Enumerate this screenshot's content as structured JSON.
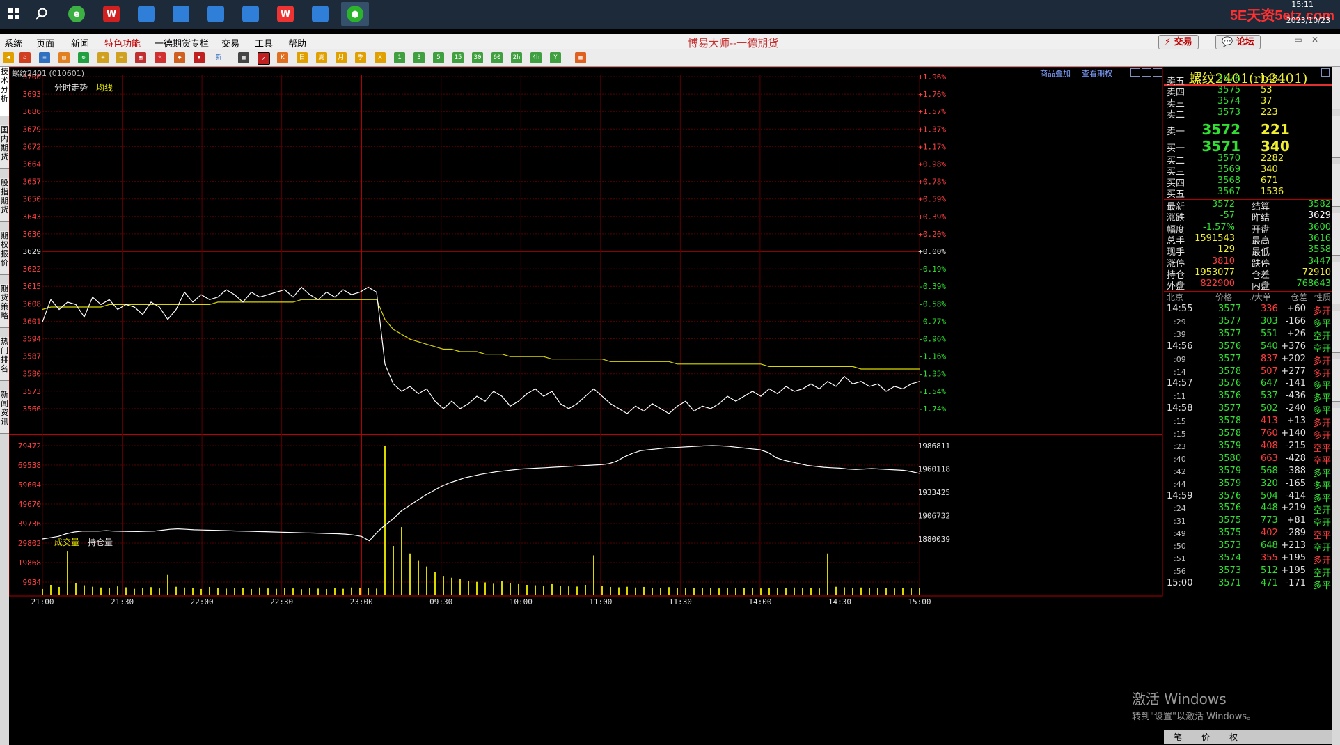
{
  "taskbar": {
    "apps": [
      {
        "icon": "windows-start-icon",
        "active": false
      },
      {
        "icon": "search-icon",
        "active": false
      },
      {
        "icon": "browser-icon",
        "active": false
      },
      {
        "icon": "wind-app-icon",
        "active": false
      },
      {
        "icon": "app-window-icon",
        "active": false
      },
      {
        "icon": "app-window-icon",
        "active": false
      },
      {
        "icon": "app-window-icon",
        "active": false
      },
      {
        "icon": "app-window-icon",
        "active": false
      },
      {
        "icon": "wps-icon",
        "active": false
      },
      {
        "icon": "app-window-icon",
        "active": false
      },
      {
        "icon": "wechat-icon",
        "active": true
      }
    ],
    "clock_time": "15:11",
    "clock_date": "2023/10/23",
    "watermark": "5E天资5etz.com"
  },
  "menubar": {
    "items": [
      "系统",
      "页面",
      "新闻",
      "特色功能",
      "一德期货专栏",
      "交易",
      "工具",
      "帮助"
    ],
    "title": "博易大师--一德期货",
    "trade_btn": "交易",
    "forum_btn": "论坛"
  },
  "left_tabs": [
    "技术分析",
    "国内期货",
    "股指期货",
    "期权报价",
    "期货策略",
    "热门排名",
    "新闻资讯"
  ],
  "chart": {
    "header_symbol": "螺纹2401 (010601)",
    "header_links": [
      "商品叠加",
      "查看期权"
    ],
    "price_legend": [
      "分时走势",
      "均线"
    ],
    "volume_legend": [
      "成交量",
      "持仓量"
    ],
    "price_ticks": [
      "3700",
      "3693",
      "3686",
      "3679",
      "3672",
      "3664",
      "3657",
      "3650",
      "3643",
      "3636",
      "3629",
      "3622",
      "3615",
      "3608",
      "3601",
      "3594",
      "3587",
      "3580",
      "3573",
      "3566"
    ],
    "pct_ticks": [
      "+1.96%",
      "+1.76%",
      "+1.57%",
      "+1.37%",
      "+1.17%",
      "+0.98%",
      "+0.78%",
      "+0.59%",
      "+0.39%",
      "+0.20%",
      "+0.00%",
      "-0.19%",
      "-0.39%",
      "-0.58%",
      "-0.77%",
      "-0.96%",
      "-1.16%",
      "-1.35%",
      "-1.54%",
      "-1.74%"
    ],
    "vol_ticks": [
      "79472",
      "69538",
      "59604",
      "49670",
      "39736",
      "29802",
      "19868",
      "9934"
    ],
    "oi_ticks": [
      "1986811",
      "1960118",
      "1933425",
      "1906732",
      "1880039"
    ],
    "time_ticks": [
      "21:00",
      "21:30",
      "22:00",
      "22:30",
      "23:00",
      "09:30",
      "10:00",
      "11:00",
      "11:30",
      "14:00",
      "14:30",
      "15:00"
    ],
    "colors": {
      "grid": "#8b0000",
      "price_line": "#ffffff",
      "avg_line": "#d8d800",
      "volume": "#d8d800",
      "oi_line": "#ffffff"
    }
  },
  "chart_data": {
    "type": "line",
    "title": "螺纹2401 (010601)",
    "prev_settle": 3629,
    "ylim": [
      3563,
      3703
    ],
    "time_labels": [
      "21:00",
      "21:30",
      "22:00",
      "22:30",
      "23:00",
      "09:30",
      "10:00",
      "11:00",
      "11:30",
      "14:00",
      "14:30",
      "15:00"
    ],
    "series": [
      {
        "name": "分时走势",
        "values": [
          3601,
          3610,
          3606,
          3609,
          3608,
          3603,
          3611,
          3608,
          3610,
          3606,
          3608,
          3607,
          3604,
          3609,
          3607,
          3602,
          3606,
          3613,
          3609,
          3612,
          3610,
          3611,
          3614,
          3612,
          3609,
          3613,
          3611,
          3612,
          3613,
          3614,
          3611,
          3615,
          3612,
          3610,
          3613,
          3611,
          3614,
          3612,
          3613,
          3615,
          3613,
          3584,
          3576,
          3573,
          3575,
          3572,
          3574,
          3569,
          3566,
          3569,
          3566,
          3568,
          3571,
          3569,
          3573,
          3571,
          3567,
          3569,
          3572,
          3574,
          3571,
          3573,
          3568,
          3566,
          3568,
          3571,
          3574,
          3571,
          3568,
          3566,
          3564,
          3567,
          3565,
          3568,
          3566,
          3564,
          3567,
          3569,
          3565,
          3567,
          3566,
          3568,
          3571,
          3569,
          3571,
          3573,
          3571,
          3574,
          3572,
          3575,
          3573,
          3574,
          3576,
          3574,
          3577,
          3575,
          3579,
          3576,
          3577,
          3575,
          3576,
          3573,
          3575,
          3574,
          3576,
          3577
        ],
        "color": "#ffffff"
      },
      {
        "name": "均线",
        "values": [
          3606,
          3607,
          3607,
          3607,
          3607,
          3607,
          3607,
          3607,
          3608,
          3608,
          3608,
          3608,
          3608,
          3608,
          3608,
          3608,
          3608,
          3608,
          3608,
          3608,
          3608,
          3609,
          3609,
          3609,
          3609,
          3609,
          3609,
          3609,
          3609,
          3609,
          3609,
          3610,
          3610,
          3610,
          3610,
          3610,
          3610,
          3610,
          3610,
          3610,
          3610,
          3602,
          3598,
          3596,
          3594,
          3593,
          3592,
          3591,
          3590,
          3590,
          3589,
          3589,
          3589,
          3588,
          3588,
          3588,
          3587,
          3587,
          3587,
          3587,
          3587,
          3586,
          3586,
          3586,
          3586,
          3586,
          3586,
          3586,
          3585,
          3585,
          3585,
          3585,
          3585,
          3585,
          3585,
          3585,
          3584,
          3584,
          3584,
          3584,
          3584,
          3584,
          3584,
          3584,
          3584,
          3584,
          3584,
          3583,
          3583,
          3583,
          3583,
          3583,
          3583,
          3583,
          3583,
          3583,
          3583,
          3583,
          3582,
          3582,
          3582,
          3582,
          3582,
          3582,
          3582,
          3582
        ],
        "color": "#d8d800"
      }
    ],
    "volume": {
      "ylim": [
        0,
        79472
      ],
      "values": [
        3000,
        5200,
        4100,
        23000,
        6000,
        5000,
        4200,
        3800,
        3500,
        4400,
        3900,
        3100,
        3600,
        4000,
        3300,
        10500,
        4200,
        3800,
        3500,
        3000,
        4100,
        3400,
        3200,
        3700,
        3500,
        3000,
        3800,
        3300,
        3100,
        3600,
        3300,
        2900,
        3500,
        3200,
        3000,
        3400,
        3100,
        3800,
        3600,
        3400,
        3200,
        79472,
        26000,
        36000,
        22000,
        18000,
        15000,
        12000,
        10000,
        9000,
        8500,
        7200,
        6800,
        6500,
        5800,
        7400,
        6000,
        5600,
        5200,
        5000,
        4800,
        5600,
        4700,
        4400,
        4300,
        5200,
        21000,
        4600,
        4100,
        3900,
        4200,
        3800,
        4100,
        3700,
        3600,
        4000,
        3700,
        3500,
        3600,
        3400,
        3700,
        3300,
        3600,
        3500,
        3400,
        3700,
        3300,
        3600,
        3400,
        3500,
        3800,
        3400,
        3600,
        3300,
        22000,
        4200,
        3900,
        3600,
        3800,
        3500,
        3400,
        3600,
        3300,
        3500,
        3300,
        3600
      ]
    },
    "open_interest": {
      "ylim": [
        1873000,
        1993000
      ],
      "values": [
        1880039,
        1881500,
        1883000,
        1886000,
        1888000,
        1889000,
        1889000,
        1889000,
        1889500,
        1889000,
        1888800,
        1888600,
        1888500,
        1888800,
        1889000,
        1890000,
        1891000,
        1891500,
        1891000,
        1890500,
        1890200,
        1890000,
        1889800,
        1889500,
        1889200,
        1889000,
        1888800,
        1888500,
        1888300,
        1888000,
        1887800,
        1887500,
        1887200,
        1887000,
        1886800,
        1886500,
        1886200,
        1886000,
        1885500,
        1884500,
        1883000,
        1878000,
        1888000,
        1896000,
        1903000,
        1912000,
        1918000,
        1924000,
        1930000,
        1935000,
        1940000,
        1944000,
        1947000,
        1950000,
        1952000,
        1954000,
        1955500,
        1957000,
        1958000,
        1959000,
        1960000,
        1960500,
        1961000,
        1961500,
        1962000,
        1962500,
        1963000,
        1963500,
        1964000,
        1964500,
        1965000,
        1966000,
        1969000,
        1974000,
        1978000,
        1981000,
        1982000,
        1983000,
        1984000,
        1984500,
        1985000,
        1985500,
        1986000,
        1986500,
        1986811,
        1986500,
        1986000,
        1985000,
        1984000,
        1983000,
        1982000,
        1979000,
        1973000,
        1970000,
        1968000,
        1966000,
        1964000,
        1963000,
        1962000,
        1961500,
        1961000,
        1960000,
        1959500,
        1960000,
        1960500,
        1960000,
        1959500,
        1959000,
        1958500,
        1957000,
        1955000
      ]
    }
  },
  "panel": {
    "title": "螺纹2401(rb2401)",
    "asks": [
      {
        "label": "卖五",
        "price": "3576",
        "vol": "148"
      },
      {
        "label": "卖四",
        "price": "3575",
        "vol": "53"
      },
      {
        "label": "卖三",
        "price": "3574",
        "vol": "37"
      },
      {
        "label": "卖二",
        "price": "3573",
        "vol": "223"
      },
      {
        "label": "卖一",
        "price": "3572",
        "vol": "221"
      }
    ],
    "bids": [
      {
        "label": "买一",
        "price": "3571",
        "vol": "340"
      },
      {
        "label": "买二",
        "price": "3570",
        "vol": "2282"
      },
      {
        "label": "买三",
        "price": "3569",
        "vol": "340"
      },
      {
        "label": "买四",
        "price": "3568",
        "vol": "671"
      },
      {
        "label": "买五",
        "price": "3567",
        "vol": "1536"
      }
    ],
    "quote": [
      {
        "l1": "最新",
        "v1": "3572",
        "c1": "green",
        "l2": "结算",
        "v2": "3582",
        "c2": "green"
      },
      {
        "l1": "涨跌",
        "v1": "-57",
        "c1": "green",
        "l2": "昨结",
        "v2": "3629",
        "c2": "white"
      },
      {
        "l1": "幅度",
        "v1": "-1.57%",
        "c1": "green",
        "l2": "开盘",
        "v2": "3600",
        "c2": "green"
      },
      {
        "l1": "总手",
        "v1": "1591543",
        "c1": "yellow",
        "l2": "最高",
        "v2": "3616",
        "c2": "green"
      },
      {
        "l1": "现手",
        "v1": "129",
        "c1": "yellow",
        "l2": "最低",
        "v2": "3558",
        "c2": "green"
      },
      {
        "l1": "涨停",
        "v1": "3810",
        "c1": "red",
        "l2": "跌停",
        "v2": "3447",
        "c2": "green"
      },
      {
        "l1": "持仓",
        "v1": "1953077",
        "c1": "yellow",
        "l2": "仓差",
        "v2": "72910",
        "c2": "yellow"
      },
      {
        "l1": "外盘",
        "v1": "822900",
        "c1": "red",
        "l2": "内盘",
        "v2": "768643",
        "c2": "green"
      }
    ],
    "trades_header": [
      "北京",
      "价格",
      "./大单",
      "仓差",
      "性质"
    ],
    "trades": [
      {
        "time": "14:55",
        "main": true,
        "price": "3577",
        "vol": "336",
        "vc": "red",
        "chg": "+60",
        "typ": "多开",
        "tc": "red"
      },
      {
        "time": ":29",
        "main": false,
        "price": "3577",
        "vol": "303",
        "vc": "green",
        "chg": "-166",
        "typ": "多平",
        "tc": "green"
      },
      {
        "time": ":39",
        "main": false,
        "price": "3577",
        "vol": "551",
        "vc": "green",
        "chg": "+26",
        "typ": "空开",
        "tc": "green"
      },
      {
        "time": "14:56",
        "main": true,
        "price": "3576",
        "vol": "540",
        "vc": "green",
        "chg": "+376",
        "typ": "空开",
        "tc": "green"
      },
      {
        "time": ":09",
        "main": false,
        "price": "3577",
        "vol": "837",
        "vc": "red",
        "chg": "+202",
        "typ": "多开",
        "tc": "red"
      },
      {
        "time": ":14",
        "main": false,
        "price": "3578",
        "vol": "507",
        "vc": "red",
        "chg": "+277",
        "typ": "多开",
        "tc": "red"
      },
      {
        "time": "14:57",
        "main": true,
        "price": "3576",
        "vol": "647",
        "vc": "green",
        "chg": "-141",
        "typ": "多平",
        "tc": "green"
      },
      {
        "time": ":11",
        "main": false,
        "price": "3576",
        "vol": "537",
        "vc": "green",
        "chg": "-436",
        "typ": "多平",
        "tc": "green"
      },
      {
        "time": "14:58",
        "main": true,
        "price": "3577",
        "vol": "502",
        "vc": "green",
        "chg": "-240",
        "typ": "多平",
        "tc": "green"
      },
      {
        "time": ":15",
        "main": false,
        "price": "3578",
        "vol": "413",
        "vc": "red",
        "chg": "+13",
        "typ": "多开",
        "tc": "red"
      },
      {
        "time": ":15",
        "main": false,
        "price": "3578",
        "vol": "760",
        "vc": "red",
        "chg": "+140",
        "typ": "多开",
        "tc": "red"
      },
      {
        "time": ":23",
        "main": false,
        "price": "3579",
        "vol": "408",
        "vc": "red",
        "chg": "-215",
        "typ": "空平",
        "tc": "red"
      },
      {
        "time": ":40",
        "main": false,
        "price": "3580",
        "vol": "663",
        "vc": "red",
        "chg": "-428",
        "typ": "空平",
        "tc": "red"
      },
      {
        "time": ":42",
        "main": false,
        "price": "3579",
        "vol": "568",
        "vc": "green",
        "chg": "-388",
        "typ": "多平",
        "tc": "green"
      },
      {
        "time": ":44",
        "main": false,
        "price": "3579",
        "vol": "320",
        "vc": "green",
        "chg": "-165",
        "typ": "多平",
        "tc": "green"
      },
      {
        "time": "14:59",
        "main": true,
        "price": "3576",
        "vol": "504",
        "vc": "green",
        "chg": "-414",
        "typ": "多平",
        "tc": "green"
      },
      {
        "time": ":24",
        "main": false,
        "price": "3576",
        "vol": "448",
        "vc": "green",
        "chg": "+219",
        "typ": "空开",
        "tc": "green"
      },
      {
        "time": ":31",
        "main": false,
        "price": "3575",
        "vol": "773",
        "vc": "green",
        "chg": "+81",
        "typ": "空开",
        "tc": "green"
      },
      {
        "time": ":49",
        "main": false,
        "price": "3575",
        "vol": "402",
        "vc": "red",
        "chg": "-289",
        "typ": "空平",
        "tc": "red"
      },
      {
        "time": ":50",
        "main": false,
        "price": "3573",
        "vol": "648",
        "vc": "green",
        "chg": "+213",
        "typ": "空开",
        "tc": "green"
      },
      {
        "time": ":51",
        "main": false,
        "price": "3574",
        "vol": "355",
        "vc": "red",
        "chg": "+195",
        "typ": "多开",
        "tc": "red"
      },
      {
        "time": ":56",
        "main": false,
        "price": "3573",
        "vol": "512",
        "vc": "green",
        "chg": "+195",
        "typ": "空开",
        "tc": "green"
      },
      {
        "time": "15:00",
        "main": true,
        "price": "3571",
        "vol": "471",
        "vc": "green",
        "chg": "-171",
        "typ": "多平",
        "tc": "green"
      }
    ],
    "bottom_tabs": [
      "笔",
      "价",
      "权"
    ]
  },
  "overlay": {
    "activate": "激活 Windows",
    "activate_sub": "转到\"设置\"以激活 Windows。"
  }
}
